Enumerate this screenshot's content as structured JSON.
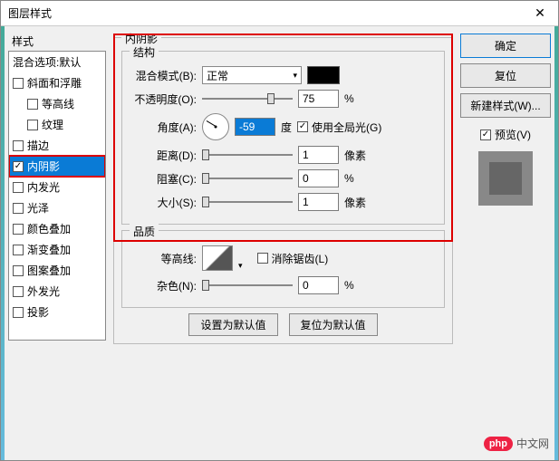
{
  "window": {
    "title": "图层样式"
  },
  "left": {
    "label": "样式",
    "header": "混合选项:默认",
    "items": [
      {
        "label": "斜面和浮雕",
        "checked": false,
        "indent": false
      },
      {
        "label": "等高线",
        "checked": false,
        "indent": true
      },
      {
        "label": "纹理",
        "checked": false,
        "indent": true
      },
      {
        "label": "描边",
        "checked": false,
        "indent": false
      },
      {
        "label": "内阴影",
        "checked": true,
        "indent": false,
        "selected": true
      },
      {
        "label": "内发光",
        "checked": false,
        "indent": false
      },
      {
        "label": "光泽",
        "checked": false,
        "indent": false
      },
      {
        "label": "颜色叠加",
        "checked": false,
        "indent": false
      },
      {
        "label": "渐变叠加",
        "checked": false,
        "indent": false
      },
      {
        "label": "图案叠加",
        "checked": false,
        "indent": false
      },
      {
        "label": "外发光",
        "checked": false,
        "indent": false
      },
      {
        "label": "投影",
        "checked": false,
        "indent": false
      }
    ]
  },
  "center": {
    "section1_title": "内阴影",
    "structure_title": "结构",
    "blend_mode_label": "混合模式(B):",
    "blend_mode_value": "正常",
    "opacity_label": "不透明度(O):",
    "opacity_value": "75",
    "opacity_unit": "%",
    "angle_label": "角度(A):",
    "angle_value": "-59",
    "angle_unit": "度",
    "global_light_label": "使用全局光(G)",
    "distance_label": "距离(D):",
    "distance_value": "1",
    "distance_unit": "像素",
    "choke_label": "阻塞(C):",
    "choke_value": "0",
    "choke_unit": "%",
    "size_label": "大小(S):",
    "size_value": "1",
    "size_unit": "像素",
    "quality_title": "品质",
    "contour_label": "等高线:",
    "antialias_label": "消除锯齿(L)",
    "noise_label": "杂色(N):",
    "noise_value": "0",
    "noise_unit": "%",
    "btn_default": "设置为默认值",
    "btn_reset": "复位为默认值",
    "color_swatch": "#000000"
  },
  "right": {
    "ok": "确定",
    "reset": "复位",
    "new_style": "新建样式(W)...",
    "preview_label": "预览(V)"
  },
  "watermark": {
    "logo": "php",
    "text": "中文网"
  }
}
